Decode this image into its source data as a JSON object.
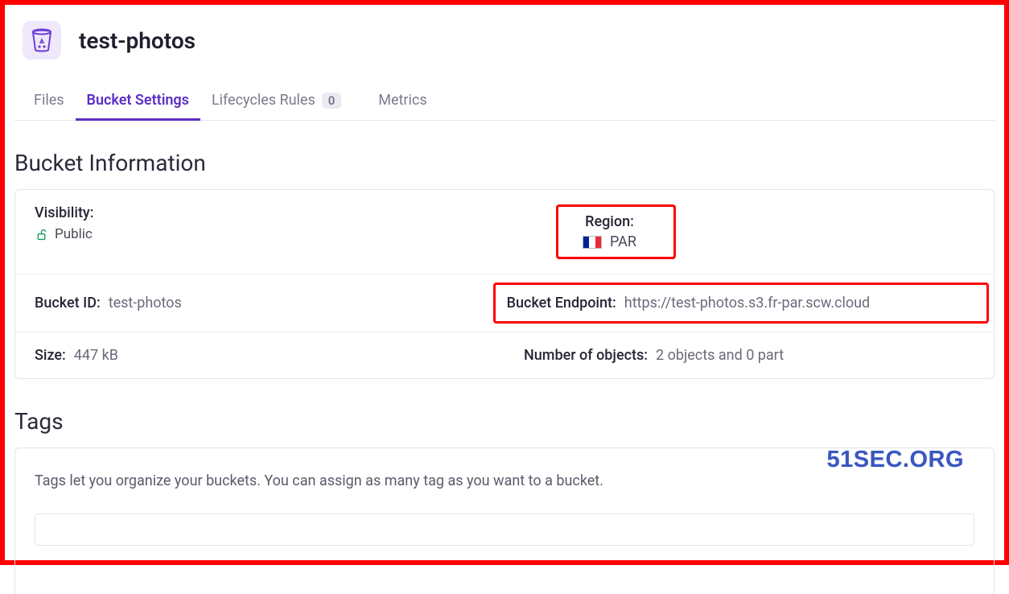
{
  "header": {
    "title": "test-photos"
  },
  "tabs": {
    "files": "Files",
    "bucket_settings": "Bucket Settings",
    "lifecycle_rules": "Lifecycles Rules",
    "lifecycle_count": "0",
    "metrics": "Metrics"
  },
  "bucket_info": {
    "section_title": "Bucket Information",
    "visibility_label": "Visibility:",
    "visibility_value": "Public",
    "region_label": "Region:",
    "region_value": "PAR",
    "bucket_id_label": "Bucket ID:",
    "bucket_id_value": "test-photos",
    "endpoint_label": "Bucket Endpoint:",
    "endpoint_value": "https://test-photos.s3.fr-par.scw.cloud",
    "size_label": "Size:",
    "size_value": "447 kB",
    "objects_label": "Number of objects:",
    "objects_value": "2 objects and 0 part"
  },
  "tags": {
    "section_title": "Tags",
    "description": "Tags let you organize your buckets. You can assign as many tag as you want to a bucket."
  },
  "watermark": "51SEC.ORG"
}
